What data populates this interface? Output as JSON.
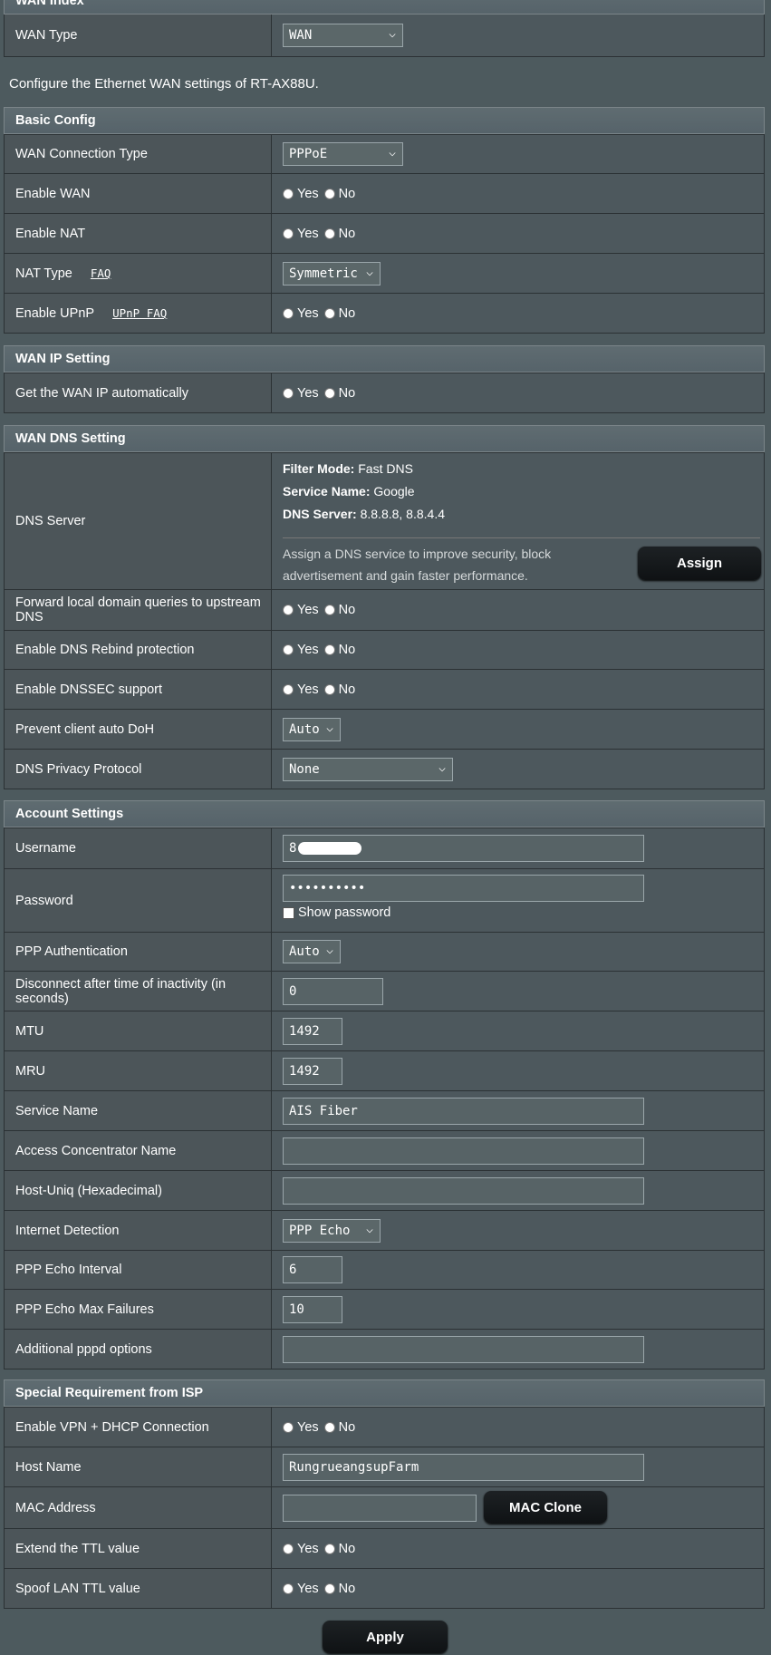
{
  "wan_index": {
    "header": "WAN Index",
    "wan_type_label": "WAN Type",
    "wan_type_value": "WAN"
  },
  "intro": "Configure the Ethernet WAN settings of RT-AX88U.",
  "basic": {
    "header": "Basic Config",
    "conn_type_label": "WAN Connection Type",
    "conn_type_value": "PPPoE",
    "enable_wan_label": "Enable WAN",
    "enable_nat_label": "Enable NAT",
    "nat_type_label": "NAT Type",
    "nat_faq": "FAQ",
    "nat_type_value": "Symmetric",
    "upnp_label": "Enable UPnP",
    "upnp_faq": "UPnP FAQ"
  },
  "wan_ip": {
    "header": "WAN IP Setting",
    "auto_label": "Get the WAN IP automatically"
  },
  "dns": {
    "header": "WAN DNS Setting",
    "server_label": "DNS Server",
    "filter_mode_key": "Filter Mode:",
    "filter_mode_val": "Fast DNS",
    "service_name_key": "Service Name:",
    "service_name_val": "Google",
    "dns_server_key": "DNS Server:",
    "dns_server_val": "8.8.8.8, 8.8.4.4",
    "assign_desc_1": "Assign a DNS service to improve security, block",
    "assign_desc_2": "advertisement and gain faster performance.",
    "assign_button": "Assign",
    "forward_label_1": "Forward local domain queries to upstream",
    "forward_label_2": "DNS",
    "rebind_label": "Enable DNS Rebind protection",
    "dnssec_label": "Enable DNSSEC support",
    "doh_label": "Prevent client auto DoH",
    "doh_value": "Auto",
    "privacy_label": "DNS Privacy Protocol",
    "privacy_value": "None"
  },
  "account": {
    "header": "Account Settings",
    "username_label": "Username",
    "username_value": "8",
    "password_label": "Password",
    "password_value": "••••••••••",
    "show_password": "Show password",
    "auth_label": "PPP Authentication",
    "auth_value": "Auto",
    "disconnect_label": "Disconnect after time of inactivity (in seconds)",
    "disconnect_value": "0",
    "mtu_label": "MTU",
    "mtu_value": "1492",
    "mru_label": "MRU",
    "mru_value": "1492",
    "service_label": "Service Name",
    "service_value": "AIS Fiber",
    "ac_label": "Access Concentrator Name",
    "ac_value": "",
    "hostuniq_label": "Host-Uniq (Hexadecimal)",
    "hostuniq_value": "",
    "detection_label": "Internet Detection",
    "detection_value": "PPP Echo",
    "echo_interval_label": "PPP Echo Interval",
    "echo_interval_value": "6",
    "echo_max_label": "PPP Echo Max Failures",
    "echo_max_value": "10",
    "pppd_label": "Additional pppd options",
    "pppd_value": ""
  },
  "special": {
    "header": "Special Requirement from ISP",
    "vpn_dhcp_label": "Enable VPN + DHCP Connection",
    "host_label": "Host Name",
    "host_value": "RungrueangsupFarm",
    "mac_label": "MAC Address",
    "mac_value": "",
    "mac_clone_button": "MAC Clone",
    "ttl_label": "Extend the TTL value",
    "spoof_ttl_label": "Spoof LAN TTL value"
  },
  "radio": {
    "yes": "Yes",
    "no": "No"
  },
  "apply_button": "Apply"
}
